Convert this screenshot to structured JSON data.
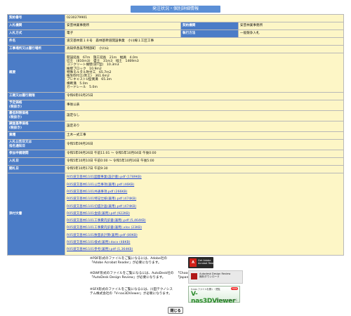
{
  "title": "発注状況・個別詳細情報",
  "rows": {
    "contract_no": {
      "label": "契約番号",
      "value": "0230279901"
    },
    "org": {
      "label": "入札機関",
      "value": "安芸林業事務所",
      "label2": "契約機関",
      "value2": "安芸林業事務所"
    },
    "method": {
      "label": "入札方式",
      "value": "電子",
      "label2": "執行方法",
      "value2": "一般競争入札"
    },
    "project": {
      "label": "件名",
      "value": "道交基林第１８号　森林基幹道開設事業　小川線１工区工事"
    },
    "location": {
      "label": "工事場所又は履行場所",
      "value": "高知県香美市物部町　小川山"
    },
    "summary": {
      "label": "概要",
      "lines": [
        "開設延長　67m　施工延長　21m　幅員　4.0m",
        "切土　(810m3)　盛土　31m3　排土　1469m3",
        "コンクリート擁壁(逆T型)　10.3m3",
        "擁壁ブロック　10.9m2",
        "特殊モルタル吹付工　65.7m2",
        "植生吹付工(吹工)　361.6m2",
        "プレキャストU型側溝　65.3m",
        "横断溝　5.0m",
        "ガードレール　5.0m"
      ]
    },
    "deadline": {
      "label": "工期又は履行期限",
      "value": "令和6年03月25日"
    },
    "estimate": {
      "label": "予定価格\n(税抜き)",
      "value": "事後公表"
    },
    "min_price": {
      "label": "最低制限価格\n(税抜き)",
      "value": "設定なし"
    },
    "survey_price": {
      "label": "調査基準価格\n(税抜き)",
      "value": "設定あり"
    },
    "category": {
      "label": "業種",
      "value": "土木一式工事"
    },
    "announce": {
      "label": "入札公告日又は\n指名通知日",
      "value": "令和5年09月26日"
    },
    "apply": {
      "label": "参加申請期間",
      "value": "令和5年09月26日 午前11:01 ～ 令和5年10月04日 午後0:00"
    },
    "bid": {
      "label": "入札日",
      "value": "令和5年10月10日 午前0:00 ～ 令和5年10月16日 午後5:00"
    },
    "open": {
      "label": "開札日",
      "value": "令和5年10月17日 午前9:30"
    },
    "docs": {
      "label": "添付文書",
      "files": [
        "R05道交基林1101図面事業(設計書).pdf (1789KB)",
        "R05道交基林1101公告事項(兼用).pdf (46KB)",
        "R05道交基林1101共通事項.pdf (266KB)",
        "R05道交基林1101特記仕様(兼用).pdf (474KB)",
        "R05道交基林1101切盛計画(兼用).pdf (474KB)",
        "R05道交基林1101金抜(兼用).pdf (922KB)",
        "R05道交基林1101工事費内訳書(兼用).pdf (5,464KB)",
        "R05道交基林1101工事費内訳書(兼用).xlsx (23KB)",
        "R05道交基林1101数量表計算(兼用).pdf (80KB)",
        "R05道交基林1101様式(兼用).docx (48KB)",
        "R05道交基林1101参考(兼用).pdf (1,364KB)"
      ]
    }
  },
  "notes": {
    "pdf": [
      "※PDF形式のファイルをご覧になるには、Adobe社の",
      "「Adobe Acrobat Reader」が必要になります。"
    ],
    "dwf": [
      "※DWF形式のファイルをご覧になるには、AutoDesk社の",
      "「AutoDesk Design Review」が必要になります。",
      "「Choose Your MSI Language」より",
      "「Japanese」を選択してください。"
    ],
    "sfx": [
      "※SFX形式のファイルをご覧になるには、川田テクノシス",
      "テム株式会社の「V-nas3DViewer」が必要になります。"
    ]
  },
  "badges": {
    "adobe": {
      "logo": "A",
      "text": "Get Adobe\nAcrobat Reader"
    },
    "dwf": {
      "text": "Autodesk Design Review\n無料ダウンロード"
    },
    "vnas": {
      "small": "V-nas ファイルを開く・閲覧",
      "new": "FREE",
      "big": "V-nas3DViewer",
      "dl": "ダウンロードはこちら"
    }
  },
  "close_label": "閉じる"
}
